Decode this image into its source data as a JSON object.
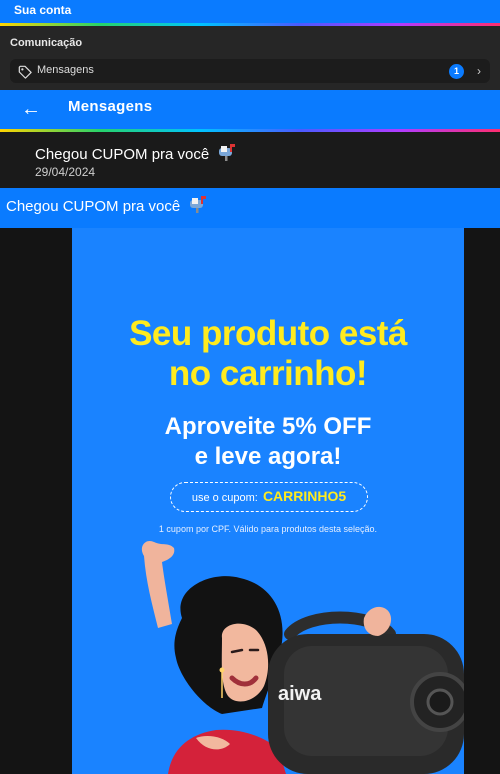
{
  "topbar": {
    "title": "Sua conta"
  },
  "section": {
    "title": "Comunicação",
    "row": {
      "label": "Mensagens",
      "badge": "1"
    }
  },
  "messages_header": {
    "title": "Mensagens"
  },
  "message": {
    "subject": "Chegou CUPOM pra você",
    "date": "29/04/2024"
  },
  "opened_message": {
    "subject": "Chegou CUPOM pra você"
  },
  "banner": {
    "headline_line1": "Seu produto está",
    "headline_line2": "no carrinho!",
    "sub_line1": "Aproveite 5% OFF",
    "sub_line2": "e leve agora!",
    "coupon_prefix": "use o cupom:",
    "coupon_code": "CARRINHO5",
    "fine_print": "1 cupom por CPF. Válido para produtos desta seleção.",
    "speaker_brand": "aiwa"
  },
  "colors": {
    "accent": "#0a7bff",
    "banner_bg": "#1a83ff",
    "headline": "#ffeb1f"
  }
}
